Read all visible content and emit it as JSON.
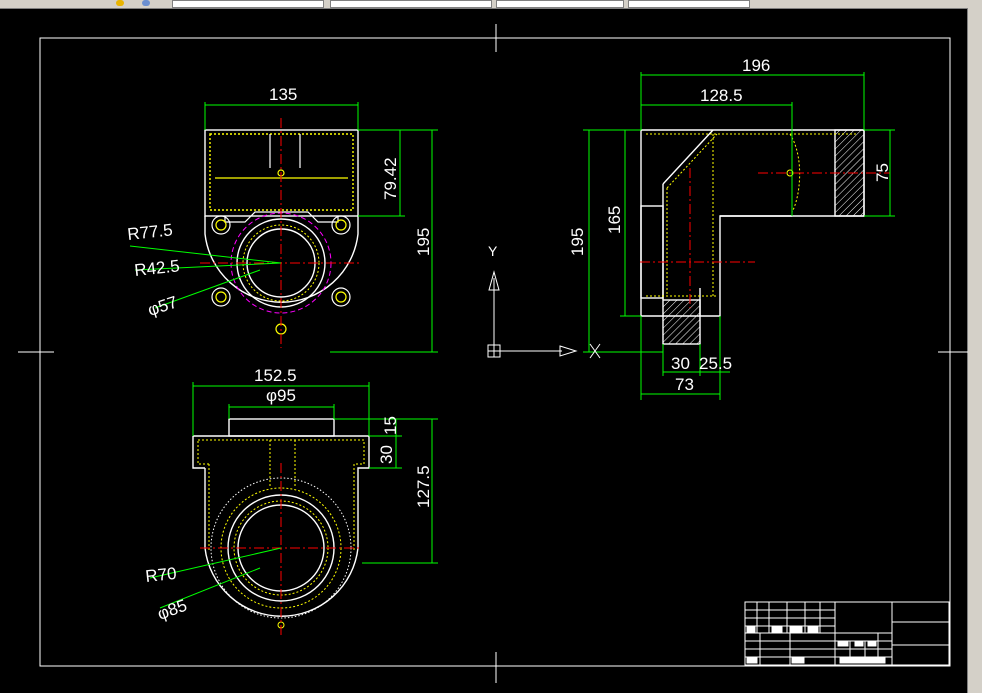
{
  "colors": {
    "background": "#000000",
    "frame": "#ffffff",
    "outline": "#ffffff",
    "hidden_line": "#ffff00",
    "dimension": "#00ff00",
    "centerline": "#ff0000",
    "circle": "#ff00ff",
    "toolbar": "#d4d0c8"
  },
  "toolbar": {
    "icons": [
      "layer-icon",
      "layer-state-icon"
    ]
  },
  "front_view": {
    "dims": {
      "width_top": "135",
      "height_top": "79.42",
      "height_total": "195",
      "r_outer": "R77.5",
      "r_bolt": "R42.5",
      "dia_bore": "φ57"
    }
  },
  "side_view": {
    "dims": {
      "width_total": "196",
      "width_elbow": "128.5",
      "height_total": "195",
      "height_inner": "165",
      "flange_height": "75",
      "base_30": "30",
      "base_25_5": "25.5",
      "base_total": "73"
    }
  },
  "bottom_view": {
    "dims": {
      "width_flange": "152.5",
      "dia_top": "φ95",
      "thick_15": "15",
      "thick_30": "30",
      "height_total": "127.5",
      "r_outer": "R70",
      "dia_bore": "φ85"
    }
  },
  "ucs": {
    "y_label": "Y",
    "x_label": "X"
  }
}
